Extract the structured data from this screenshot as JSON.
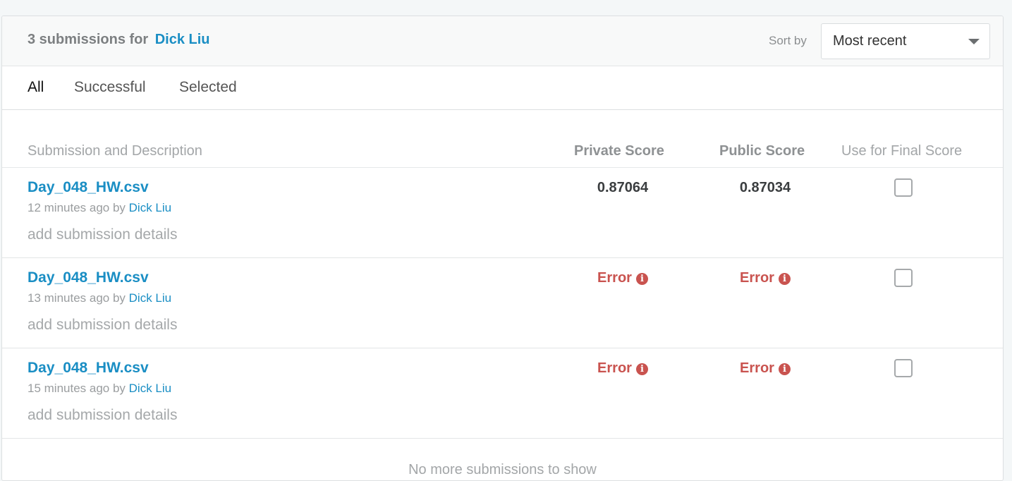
{
  "header": {
    "count_text": "3 submissions for",
    "user_name": "Dick Liu",
    "sort_label": "Sort by",
    "sort_value": "Most recent"
  },
  "tabs": [
    {
      "label": "All",
      "active": true
    },
    {
      "label": "Successful",
      "active": false
    },
    {
      "label": "Selected",
      "active": false
    }
  ],
  "columns": {
    "submission": "Submission and Description",
    "private": "Private Score",
    "public": "Public Score",
    "final": "Use for Final Score"
  },
  "submissions": [
    {
      "file": "Day_048_HW.csv",
      "time": "12 minutes ago by",
      "author": "Dick Liu",
      "details": "add submission details",
      "private_score": "0.87064",
      "public_score": "0.87034",
      "selected": false
    },
    {
      "file": "Day_048_HW.csv",
      "time": "13 minutes ago by",
      "author": "Dick Liu",
      "details": "add submission details",
      "private_score": "Error",
      "public_score": "Error",
      "selected": false
    },
    {
      "file": "Day_048_HW.csv",
      "time": "15 minutes ago by",
      "author": "Dick Liu",
      "details": "add submission details",
      "private_score": "Error",
      "public_score": "Error",
      "selected": false
    }
  ],
  "footer": {
    "text": "No more submissions to show"
  },
  "colors": {
    "link": "#1a8ec4",
    "error": "#c9534f"
  },
  "icons": {
    "error_info": "info-circle-icon",
    "sort_caret": "chevron-down-icon"
  }
}
